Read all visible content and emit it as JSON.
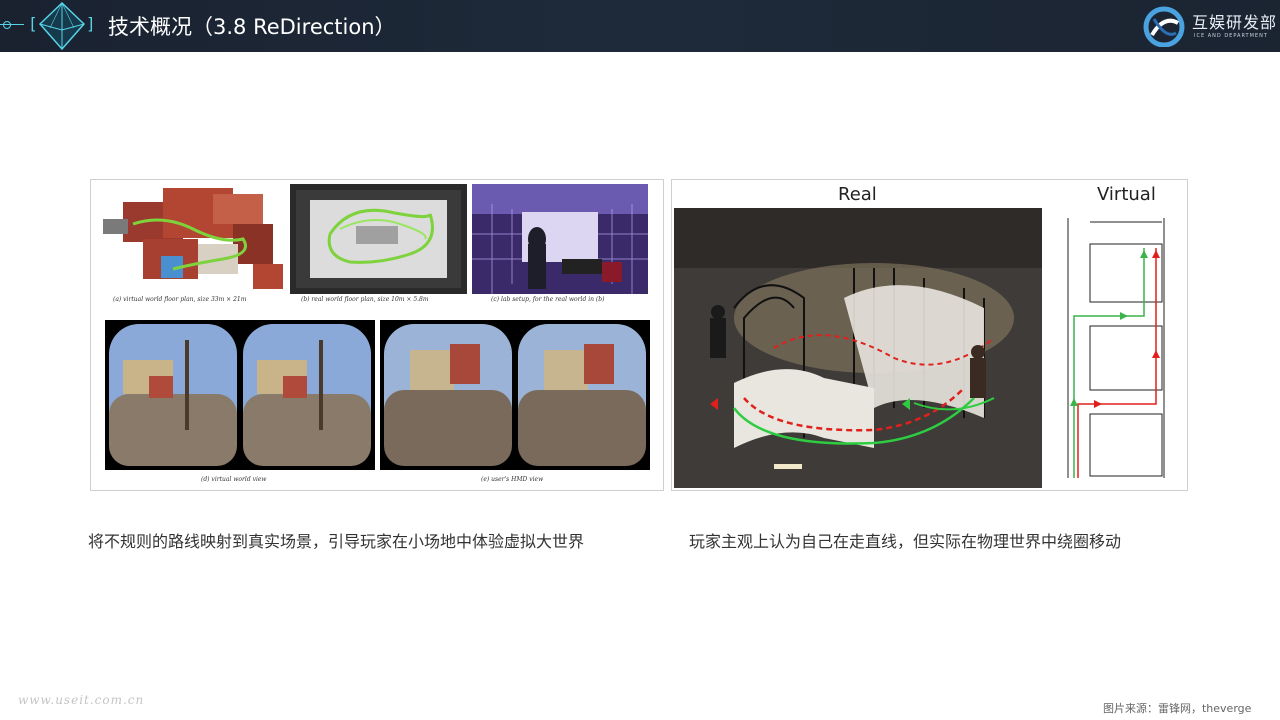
{
  "header": {
    "title": "技术概况（3.8 ReDirection）",
    "logo_text": "互娱研发部",
    "logo_subtext": "ICE AND DEPARTMENT"
  },
  "left_figure": {
    "caption_a": "(a) virtual world floor plan, size 33m × 21m",
    "caption_b": "(b) real world floor plan, size 10m × 5.8m",
    "caption_c": "(c) lab setup, for the real world in (b)",
    "caption_d": "(d) virtual world view",
    "caption_e": "(e) user's HMD view"
  },
  "right_figure": {
    "label_real": "Real",
    "label_virtual": "Virtual"
  },
  "captions": {
    "left": "将不规则的路线映射到真实场景，引导玩家在小场地中体验虚拟大世界",
    "right": "玩家主观上认为自己在走直线，但实际在物理世界中绕圈移动"
  },
  "footer": {
    "watermark": "www.useit.com.cn",
    "source": "图片来源：雷锋网，theverge"
  },
  "colors": {
    "header_bg": "#1e2a3a",
    "accent": "#57d3e6",
    "path_green": "#3cb44b",
    "path_red": "#e0201b"
  }
}
